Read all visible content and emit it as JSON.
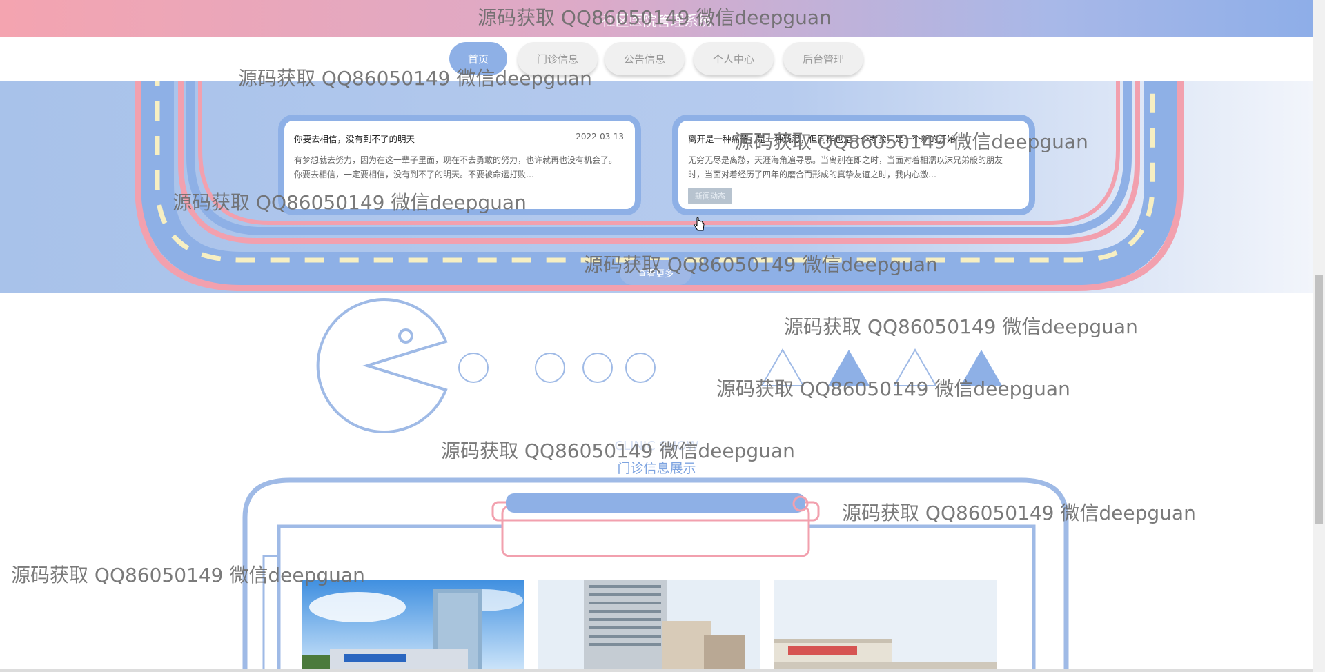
{
  "header": {
    "title": "社区医院管理系统",
    "nav": [
      {
        "label": "首页",
        "active": true
      },
      {
        "label": "门诊信息",
        "active": false
      },
      {
        "label": "公告信息",
        "active": false
      },
      {
        "label": "个人中心",
        "active": false
      },
      {
        "label": "后台管理",
        "active": false
      }
    ]
  },
  "news": {
    "cards": [
      {
        "title": "你要去相信，没有到不了的明天",
        "date": "2022-03-13",
        "body": "有梦想就去努力，因为在这一辈子里面，现在不去勇敢的努力，也许就再也没有机会了。你要去相信，一定要相信，没有到不了的明天。不要被命运打败…",
        "tag": ""
      },
      {
        "title": "离开是一种痛苦，是一种残忍，但同样也是一个考验，是一个新的开始",
        "date": "",
        "body": "无穷无尽是离愁，天涯海角遍寻思。当离别在即之时，当面对着相濡以沫兄弟般的朋友时，当面对着经历了四年的磨合而形成的真挚友谊之时，我内心激…",
        "tag": "新闻动态"
      }
    ],
    "more_label": "查看更多"
  },
  "clinic_section": {
    "title_en": "CLINIC SHOW",
    "title_cn": "门诊信息展示"
  },
  "colors": {
    "accent_blue": "#8eb0e6",
    "accent_pink": "#f2a0ae",
    "road_dash": "#f7efc2"
  },
  "watermark": "源码获取 QQ86050149 微信deepguan"
}
